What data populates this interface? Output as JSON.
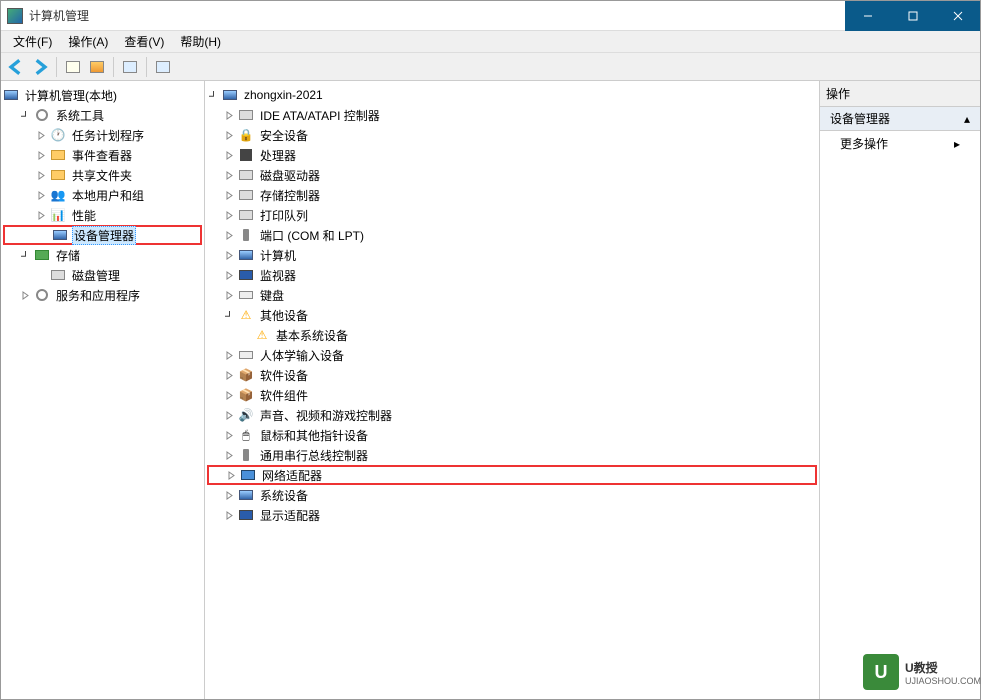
{
  "titlebar": {
    "title": "计算机管理"
  },
  "menubar": {
    "file": "文件(F)",
    "action": "操作(A)",
    "view": "查看(V)",
    "help": "帮助(H)"
  },
  "left_tree": {
    "root": "计算机管理(本地)",
    "system_tools": "系统工具",
    "task_scheduler": "任务计划程序",
    "event_viewer": "事件查看器",
    "shared_folders": "共享文件夹",
    "local_users": "本地用户和组",
    "performance": "性能",
    "device_manager": "设备管理器",
    "storage": "存储",
    "disk_mgmt": "磁盘管理",
    "services_apps": "服务和应用程序"
  },
  "center_tree": {
    "root": "zhongxin-2021",
    "ide": "IDE ATA/ATAPI 控制器",
    "security": "安全设备",
    "cpu": "处理器",
    "disk_drive": "磁盘驱动器",
    "storage_ctrl": "存储控制器",
    "print_queue": "打印队列",
    "ports": "端口 (COM 和 LPT)",
    "computer": "计算机",
    "monitor": "监视器",
    "keyboard": "键盘",
    "other": "其他设备",
    "other_basic": "基本系统设备",
    "hid": "人体学输入设备",
    "sw_dev": "软件设备",
    "sw_comp": "软件组件",
    "audio": "声音、视频和游戏控制器",
    "mouse": "鼠标和其他指针设备",
    "usb": "通用串行总线控制器",
    "network": "网络适配器",
    "system_dev": "系统设备",
    "display": "显示适配器"
  },
  "actions": {
    "header": "操作",
    "sub": "设备管理器",
    "more": "更多操作"
  },
  "watermark": {
    "brand": "U教授",
    "url": "UJIAOSHOU.COM"
  }
}
